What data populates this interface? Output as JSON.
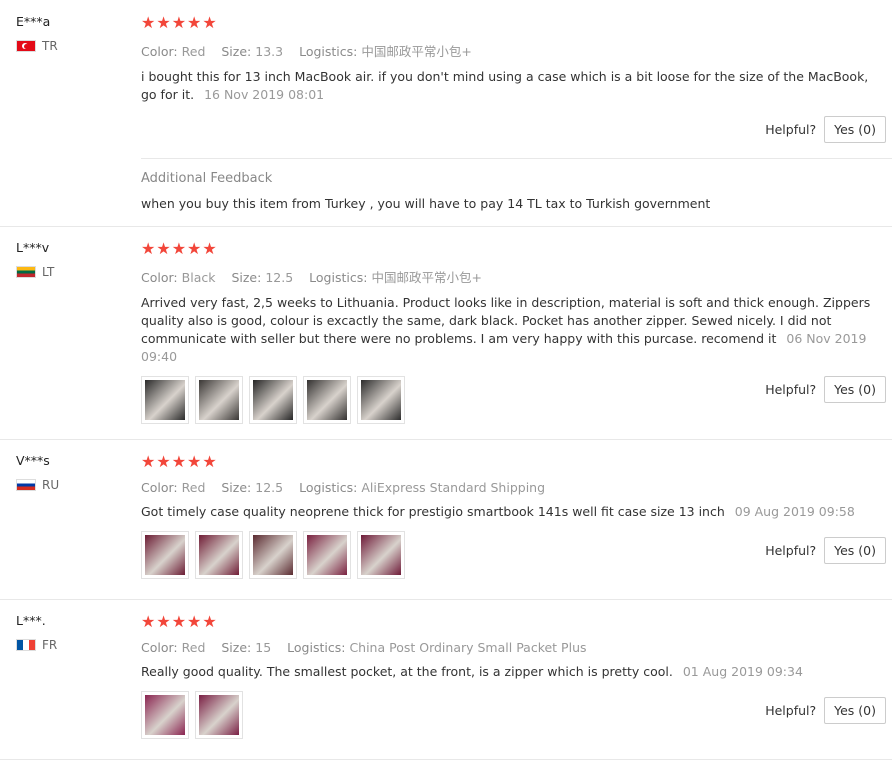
{
  "helpful_label": "Helpful?",
  "star_color": "#f2463a",
  "reviews": [
    {
      "user": "E***a",
      "country": "TR",
      "stars": "★★★★★",
      "color_label": "Color:",
      "color": "Red",
      "size_label": "Size:",
      "size": "13.3",
      "logistics_label": "Logistics:",
      "logistics": "中国邮政平常小包+",
      "text": "i bought this for 13 inch MacBook air. if you don't mind using a case which is a bit loose for the size of the MacBook, go for it.",
      "date": "16 Nov 2019 08:01",
      "yes": "Yes (0)",
      "additional_title": "Additional Feedback",
      "additional_text": "when you buy this item from Turkey , you will have to pay 14 TL tax to Turkish government"
    },
    {
      "user": "L***v",
      "country": "LT",
      "stars": "★★★★★",
      "color_label": "Color:",
      "color": "Black",
      "size_label": "Size:",
      "size": "12.5",
      "logistics_label": "Logistics:",
      "logistics": "中国邮政平常小包+",
      "text": "Arrived very fast, 2,5 weeks to Lithuania. Product looks like in description, material is soft and thick enough. Zippers quality also is good, colour is excactly the same, dark black. Pocket has another zipper. Sewed nicely. I did not communicate with seller but there were no problems. I am very happy with this purcase. recomend it",
      "date": "06 Nov 2019 09:40",
      "yes": "Yes (0)",
      "thumb_colors": [
        "#2a2a2a",
        "#3a3735",
        "#252525",
        "#333130",
        "#2c2c2c"
      ]
    },
    {
      "user": "V***s",
      "country": "RU",
      "stars": "★★★★★",
      "color_label": "Color:",
      "color": "Red",
      "size_label": "Size:",
      "size": "12.5",
      "logistics_label": "Logistics:",
      "logistics": "AliExpress Standard Shipping",
      "text": "Got timely case quality neoprene thick for prestigio smartbook 141s well fit case size 13 inch",
      "date": "09 Aug 2019 09:58",
      "yes": "Yes (0)",
      "thumb_colors": [
        "#6b1c34",
        "#701d36",
        "#5a2a30",
        "#7a2140",
        "#6e1a38"
      ]
    },
    {
      "user": "L***.",
      "country": "FR",
      "stars": "★★★★★",
      "color_label": "Color:",
      "color": "Red",
      "size_label": "Size:",
      "size": "15",
      "logistics_label": "Logistics:",
      "logistics": "China Post Ordinary Small Packet Plus",
      "text": "Really good quality. The smallest pocket, at the front, is a zipper which is pretty cool.",
      "date": "01 Aug 2019 09:34",
      "yes": "Yes (0)",
      "thumb_colors": [
        "#8a2450",
        "#7a1f44"
      ]
    }
  ]
}
